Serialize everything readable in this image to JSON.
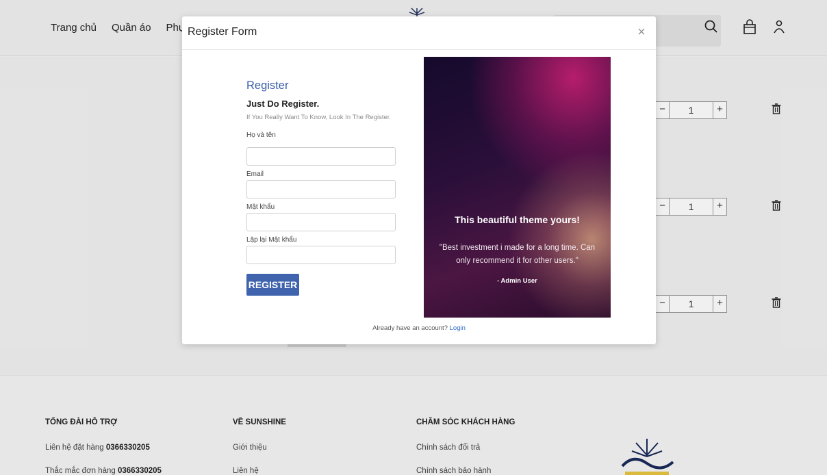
{
  "header": {
    "nav": [
      "Trang chủ",
      "Quần áo",
      "Phụ"
    ]
  },
  "cart": {
    "rows": [
      {
        "quantity": "1",
        "minus": "−",
        "plus": "+"
      },
      {
        "quantity": "1",
        "minus": "−",
        "plus": "+"
      },
      {
        "quantity": "1",
        "minus": "−",
        "plus": "+"
      }
    ]
  },
  "footer": {
    "columns": [
      {
        "title": "TỔNG ĐÀI HỖ TRỢ",
        "links": [
          {
            "text": "Liên hệ đặt hàng ",
            "phone": "0366330205"
          },
          {
            "text": "Thắc mắc đơn hàng ",
            "phone": "0366330205"
          }
        ]
      },
      {
        "title": "VỀ SUNSHINE",
        "links": [
          {
            "text": "Giới thiệu"
          },
          {
            "text": "Liên hệ"
          }
        ]
      },
      {
        "title": "CHĂM SÓC KHÁCH HÀNG",
        "links": [
          {
            "text": "Chính sách đổi trả"
          },
          {
            "text": "Chính sách bảo hành"
          }
        ]
      }
    ]
  },
  "modal": {
    "title": "Register Form",
    "close": "×",
    "form": {
      "heading": "Register",
      "subheading": "Just Do Register.",
      "note": "If You Really Want To Know, Look In The Register.",
      "fields": [
        {
          "label": "Họ và tên",
          "value": ""
        },
        {
          "label": "Email",
          "value": ""
        },
        {
          "label": "Mật khẩu",
          "value": ""
        },
        {
          "label": "Lặp lại Mật khẩu",
          "value": ""
        }
      ],
      "submit": "REGISTER"
    },
    "promo": {
      "title": "This beautiful theme yours!",
      "quote": "\"Best investment i made for a long time. Can only recommend it for other users.\"",
      "author": "- Admin User"
    },
    "footer_text": "Already have an account?",
    "footer_link": "Login"
  },
  "icons": {
    "search": "search-icon",
    "cart": "shopping-bag-icon",
    "user": "user-icon",
    "trash": "trash-icon",
    "close": "close-icon",
    "logo": "sunshine-logo-icon"
  },
  "colors": {
    "accent": "#3f63ad",
    "heading": "#3a5fa8",
    "link": "#2b69c8"
  }
}
